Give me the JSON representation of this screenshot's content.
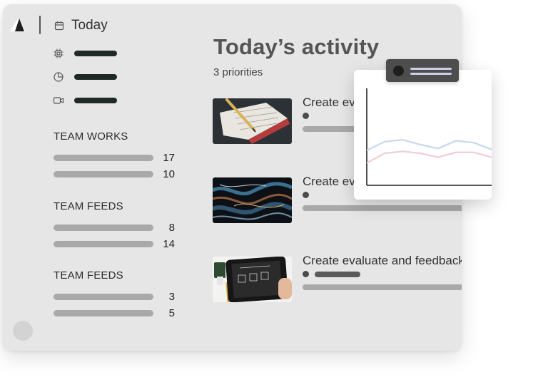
{
  "header": {
    "today_label": "Today"
  },
  "sidebar": {
    "nav_icons": [
      "chip-icon",
      "pie-chart-icon",
      "video-camera-icon"
    ],
    "groups": [
      {
        "title": "TEAM WORKS",
        "counts": [
          "17",
          "10"
        ]
      },
      {
        "title": "TEAM FEEDS",
        "counts": [
          "8",
          "14"
        ]
      },
      {
        "title": "TEAM FEEDS",
        "counts": [
          "3",
          "5"
        ]
      }
    ]
  },
  "main": {
    "title": "Today’s activity",
    "subtitle": "3 priorities",
    "activities": [
      {
        "title": "Create evaluate and feedback",
        "image": "notebook-pencil-photo"
      },
      {
        "title": "Create evaluate and feedback",
        "image": "abstract-paint-photo"
      },
      {
        "title": "Create evaluate and feedback",
        "image": "tablet-wireframe-photo"
      }
    ]
  },
  "chart_data": {
    "type": "line",
    "title": "",
    "x": [
      0,
      1,
      2,
      3,
      4,
      5,
      6,
      7
    ],
    "series": [
      {
        "values": [
          36,
          45,
          47,
          42,
          38,
          46,
          44,
          37
        ]
      },
      {
        "values": [
          23,
          33,
          35,
          33,
          29,
          34,
          34,
          29
        ]
      }
    ],
    "ylim": [
      0,
      100
    ],
    "grid": false,
    "colors": {
      "series_1": "#c6d8f2",
      "series_2": "#f3cbd9",
      "axis": "#222222"
    }
  },
  "colors": {
    "window_bg": "#e6e6e6",
    "nav_pill": "#1f2a27",
    "placeholder_bar": "#a9a9a9"
  }
}
